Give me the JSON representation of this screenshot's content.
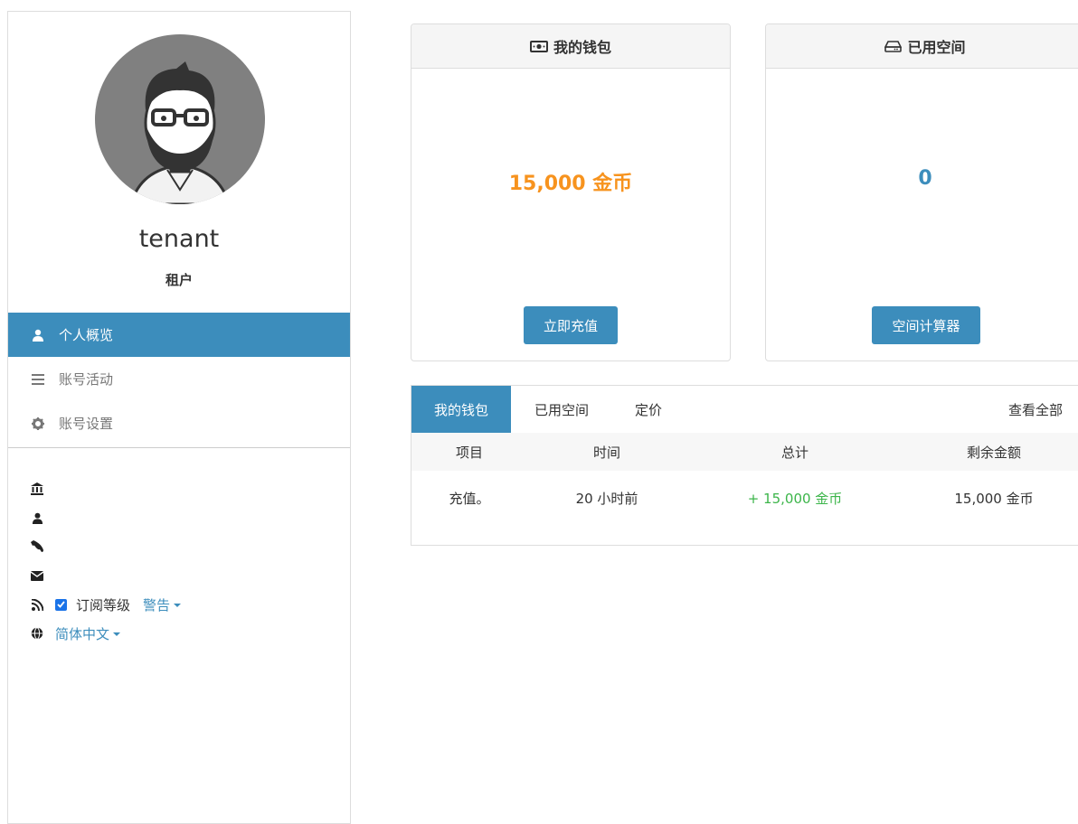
{
  "profile": {
    "username": "tenant",
    "role": "租户"
  },
  "nav": [
    {
      "label": "个人概览",
      "icon": "user-icon",
      "active": true
    },
    {
      "label": "账号活动",
      "icon": "list-icon",
      "active": false
    },
    {
      "label": "账号设置",
      "icon": "gear-icon",
      "active": false
    }
  ],
  "info": {
    "subscribe_label": "订阅等级",
    "subscribe_level": "警告",
    "language": "简体中文"
  },
  "wallet_card": {
    "title": "我的钱包",
    "value": "15,000 金币",
    "button": "立即充值",
    "value_color": "#f7931e"
  },
  "storage_card": {
    "title": "已用空间",
    "value": "0",
    "button": "空间计算器",
    "value_color": "#3c8dbc"
  },
  "tabs": {
    "items": [
      "我的钱包",
      "已用空间",
      "定价"
    ],
    "view_all": "查看全部"
  },
  "table": {
    "headers": [
      "项目",
      "时间",
      "总计",
      "剩余金额"
    ],
    "rows": [
      [
        "充值。",
        "20 小时前",
        "+ 15,000 金币",
        "15,000 金币"
      ]
    ]
  },
  "colors": {
    "accent": "#3c8dbc",
    "positive": "#3cb54a"
  }
}
